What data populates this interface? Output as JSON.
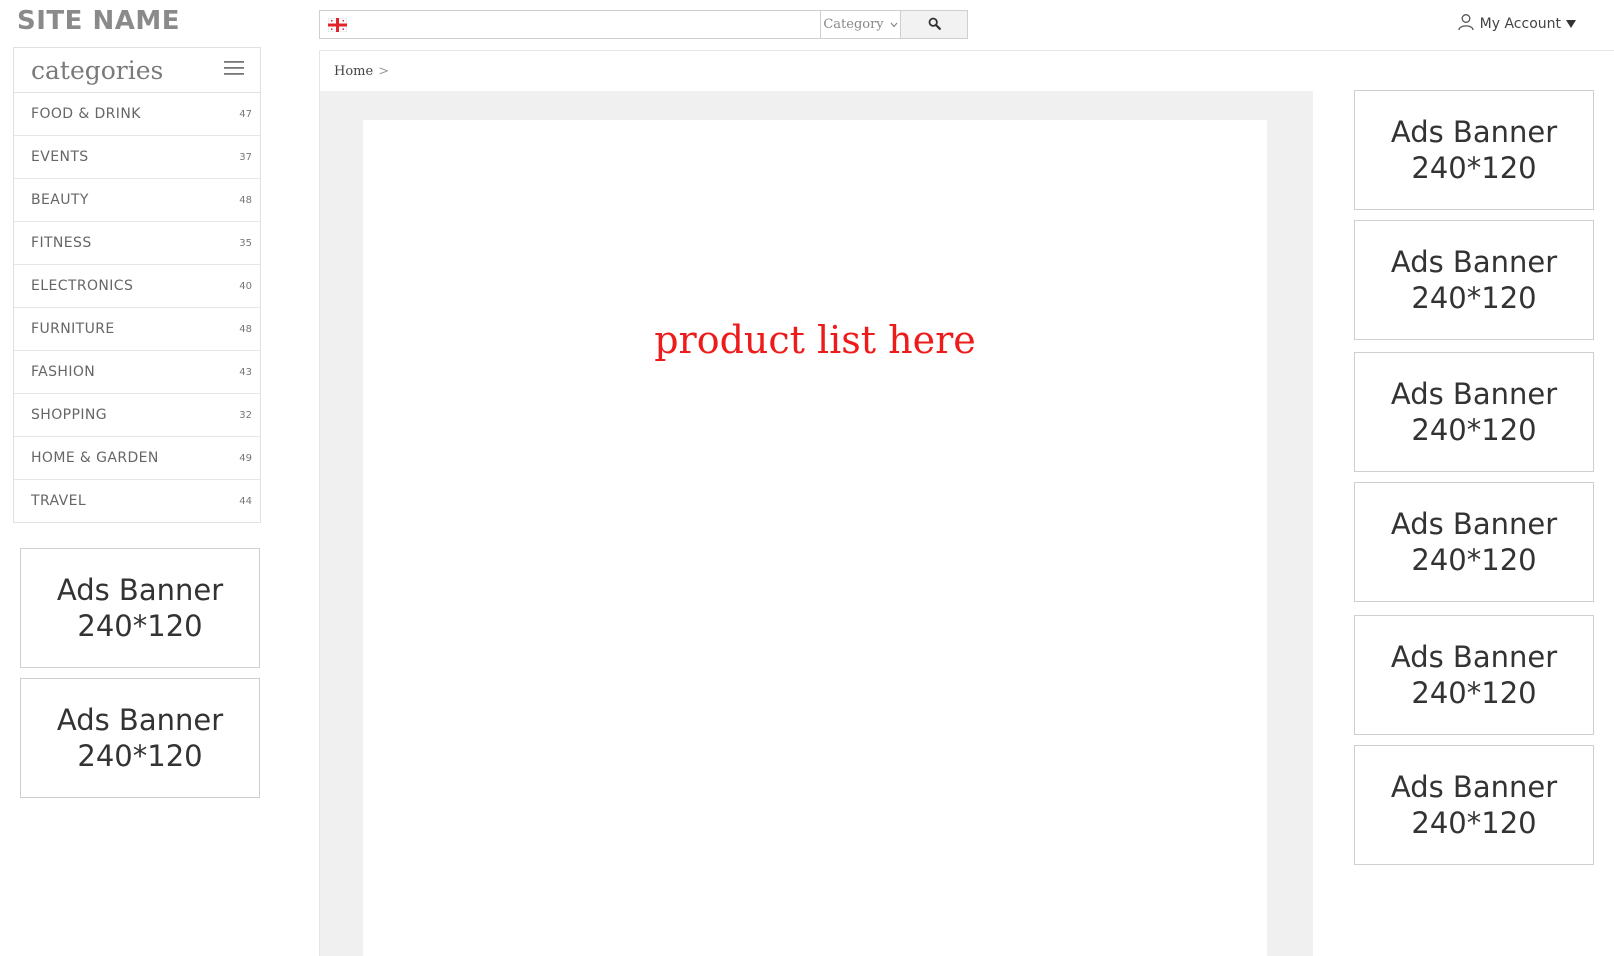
{
  "site_name": "SITE NAME",
  "search": {
    "placeholder": "",
    "category_label": "Category",
    "flag_icon": "flag-icon",
    "button_icon": "search-icon"
  },
  "account": {
    "label": "My Account",
    "icon": "user-icon"
  },
  "breadcrumb": {
    "home": "Home",
    "separator": ">"
  },
  "categories": {
    "title": "categories",
    "items": [
      {
        "label": "FOOD & DRINK",
        "count": "47"
      },
      {
        "label": "EVENTS",
        "count": "37"
      },
      {
        "label": "BEAUTY",
        "count": "48"
      },
      {
        "label": "FITNESS",
        "count": "35"
      },
      {
        "label": "ELECTRONICS",
        "count": "40"
      },
      {
        "label": "FURNITURE",
        "count": "48"
      },
      {
        "label": "FASHION",
        "count": "43"
      },
      {
        "label": "SHOPPING",
        "count": "32"
      },
      {
        "label": "HOME & GARDEN",
        "count": "49"
      },
      {
        "label": "TRAVEL",
        "count": "44"
      }
    ]
  },
  "ads": {
    "left": [
      {
        "line1": "Ads Banner",
        "line2": "240*120"
      },
      {
        "line1": "Ads Banner",
        "line2": "240*120"
      }
    ],
    "right": [
      {
        "line1": "Ads Banner",
        "line2": "240*120"
      },
      {
        "line1": "Ads Banner",
        "line2": "240*120"
      },
      {
        "line1": "Ads Banner",
        "line2": "240*120"
      },
      {
        "line1": "Ads Banner",
        "line2": "240*120"
      },
      {
        "line1": "Ads Banner",
        "line2": "240*120"
      },
      {
        "line1": "Ads Banner",
        "line2": "240*120"
      }
    ]
  },
  "main": {
    "placeholder_text": "product list here"
  },
  "colors": {
    "placeholder_text": "#ee1b1b",
    "main_bg": "#f0f0f0"
  }
}
